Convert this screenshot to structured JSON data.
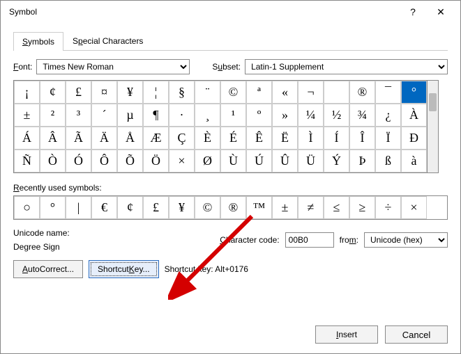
{
  "window": {
    "title": "Symbol",
    "help": "?",
    "close": "✕"
  },
  "tabs": {
    "symbols": "Symbols",
    "special": "Special Characters",
    "symbols_u": "S",
    "special_u": "P"
  },
  "font": {
    "label_pre": "F",
    "label_post": "ont:",
    "value": "Times New Roman"
  },
  "subset": {
    "label_pre": "S",
    "label_u": "u",
    "label_post": "bset:",
    "value": "Latin-1 Supplement"
  },
  "grid": [
    "¡",
    "¢",
    "£",
    "¤",
    "¥",
    "¦",
    "§",
    "¨",
    "©",
    "ª",
    "«",
    "¬",
    "­",
    "®",
    "¯",
    "°",
    "±",
    "²",
    "³",
    "´",
    "µ",
    "¶",
    "·",
    "¸",
    "¹",
    "º",
    "»",
    "¼",
    "½",
    "¾",
    "¿",
    "À",
    "Á",
    "Â",
    "Ã",
    "Ä",
    "Å",
    "Æ",
    "Ç",
    "È",
    "É",
    "Ê",
    "Ë",
    "Ì",
    "Í",
    "Î",
    "Ï",
    "Ð",
    "Ñ",
    "Ò",
    "Ó",
    "Ô",
    "Õ",
    "Ö",
    "×",
    "Ø",
    "Ù",
    "Ú",
    "Û",
    "Ü",
    "Ý",
    "Þ",
    "ß",
    "à"
  ],
  "selected_index": 15,
  "recent_label_pre": "",
  "recent_label_u": "R",
  "recent_label_post": "ecently used symbols:",
  "recent": [
    "○",
    "°",
    "|",
    "€",
    "¢",
    "£",
    "¥",
    "©",
    "®",
    "™",
    "±",
    "≠",
    "≤",
    "≥",
    "÷",
    "×"
  ],
  "uname_label": "Unicode name:",
  "uname_value": "Degree Sign",
  "charcode_label_u": "C",
  "charcode_label_post": "haracter code:",
  "charcode_value": "00B0",
  "from_label_pre": "fro",
  "from_label_u": "m",
  "from_label_post": ":",
  "from_value": "Unicode (hex)",
  "autocorrect_u": "A",
  "autocorrect_post": "utoCorrect...",
  "shortcutkey_pre": "Shortcut ",
  "shortcutkey_u": "K",
  "shortcutkey_post": "ey...",
  "shortcut_static": "Shortcut key: Alt+0176",
  "insert_u": "I",
  "insert_post": "nsert",
  "cancel": "Cancel"
}
